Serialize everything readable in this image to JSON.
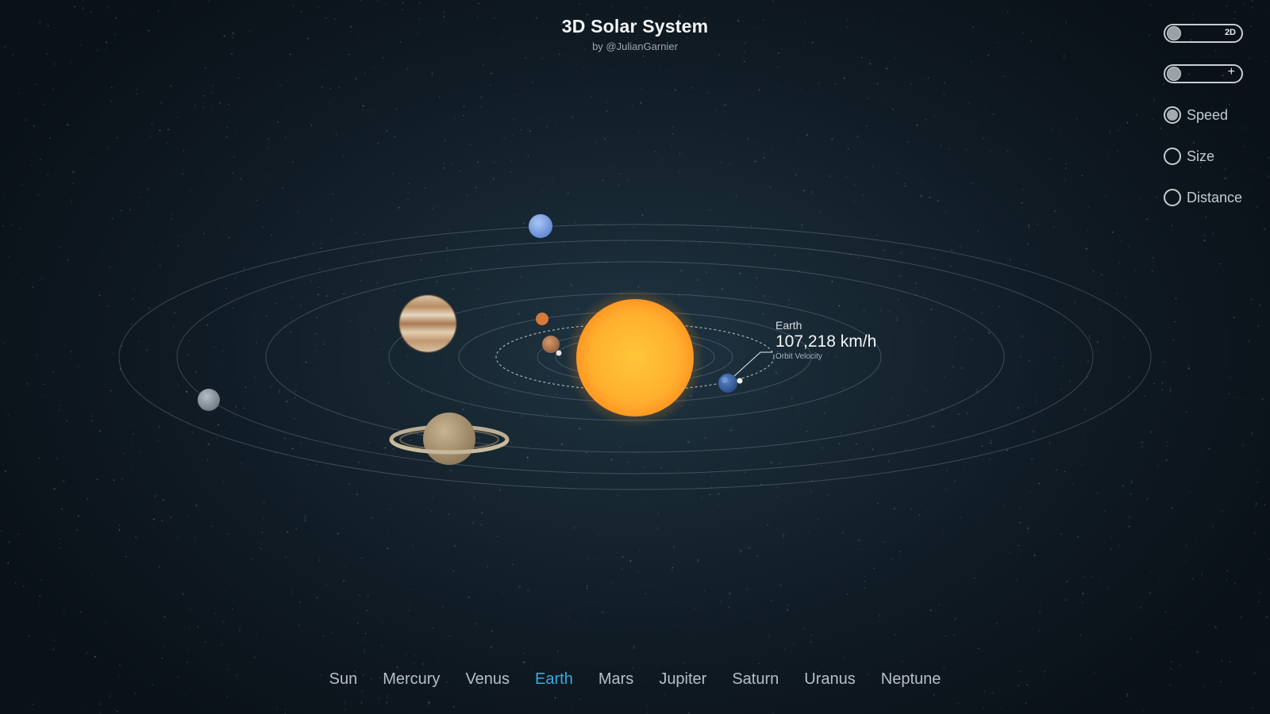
{
  "header": {
    "title": "3D Solar System",
    "byline": "by @JulianGarnier"
  },
  "controls": {
    "view_toggle_label": "2D",
    "zoom_toggle_label": "+",
    "modes": [
      {
        "label": "Speed",
        "selected": true
      },
      {
        "label": "Size",
        "selected": false
      },
      {
        "label": "Distance",
        "selected": false
      }
    ]
  },
  "info": {
    "planet": "Earth",
    "value": "107,218 km/h",
    "label": "Orbit Velocity"
  },
  "nav": {
    "items": [
      "Sun",
      "Mercury",
      "Venus",
      "Earth",
      "Mars",
      "Jupiter",
      "Saturn",
      "Uranus",
      "Neptune"
    ],
    "active": "Earth"
  },
  "colors": {
    "accent": "#3ba9e0",
    "sun": "#ffb02e",
    "background": "#16252f"
  }
}
